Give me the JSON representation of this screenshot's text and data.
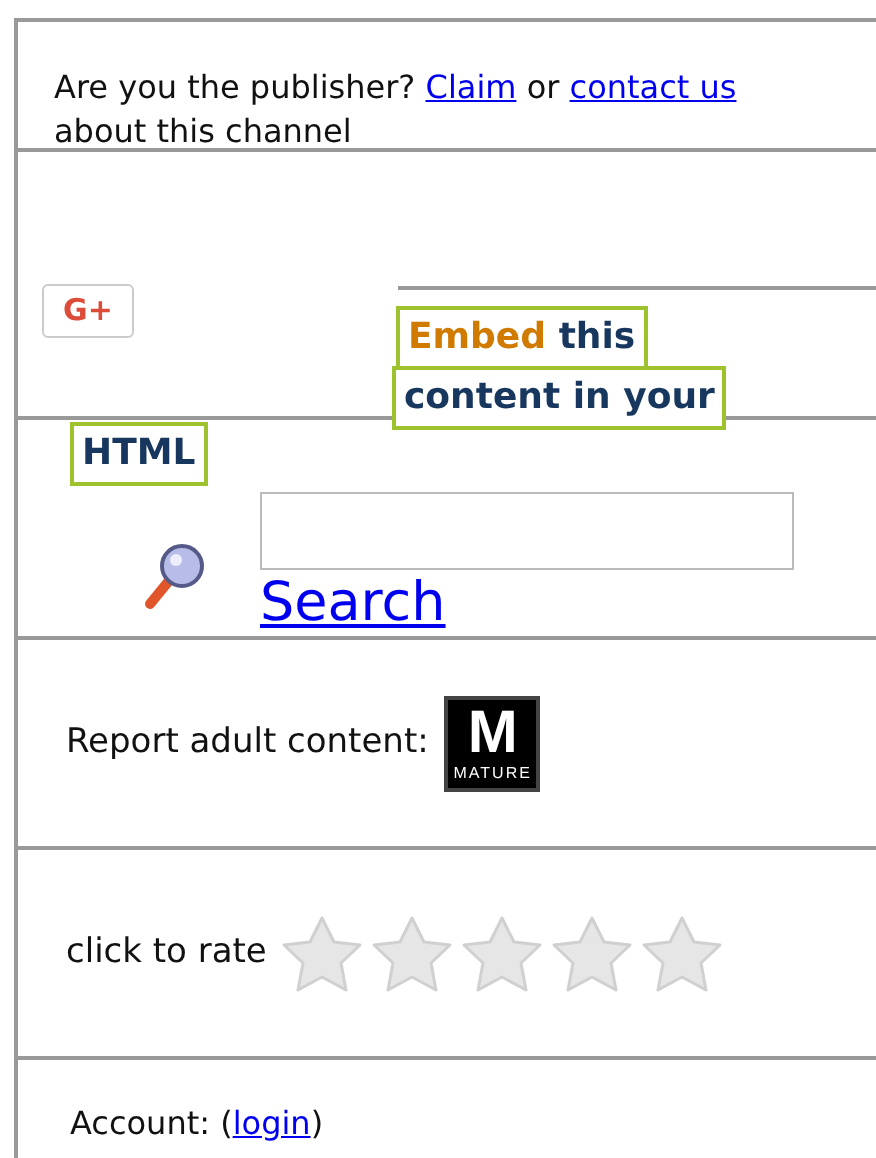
{
  "publisher_notice": {
    "segments": [
      {
        "kind": "text",
        "text": "Are you the publisher?"
      },
      {
        "kind": "link",
        "text": "Claim"
      },
      {
        "kind": "text",
        "text": "or"
      },
      {
        "kind": "link",
        "text": "contact us"
      },
      {
        "kind": "text",
        "text": "about this channel"
      }
    ]
  },
  "share_button": {
    "label": "G+"
  },
  "embed_heading": {
    "lines": [
      {
        "accent": "Embed",
        "text": "this"
      },
      {
        "text": "content in your"
      },
      {
        "text": "HTML"
      }
    ]
  },
  "search": {
    "link": "Search"
  },
  "report": {
    "label": "Report adult content:",
    "badge": {
      "letter": "M",
      "caption": "MATURE"
    }
  },
  "rating": {
    "label": "click to rate",
    "stars": 0
  },
  "account": {
    "label": "Account: (",
    "link": "login",
    "suffix": ")"
  }
}
